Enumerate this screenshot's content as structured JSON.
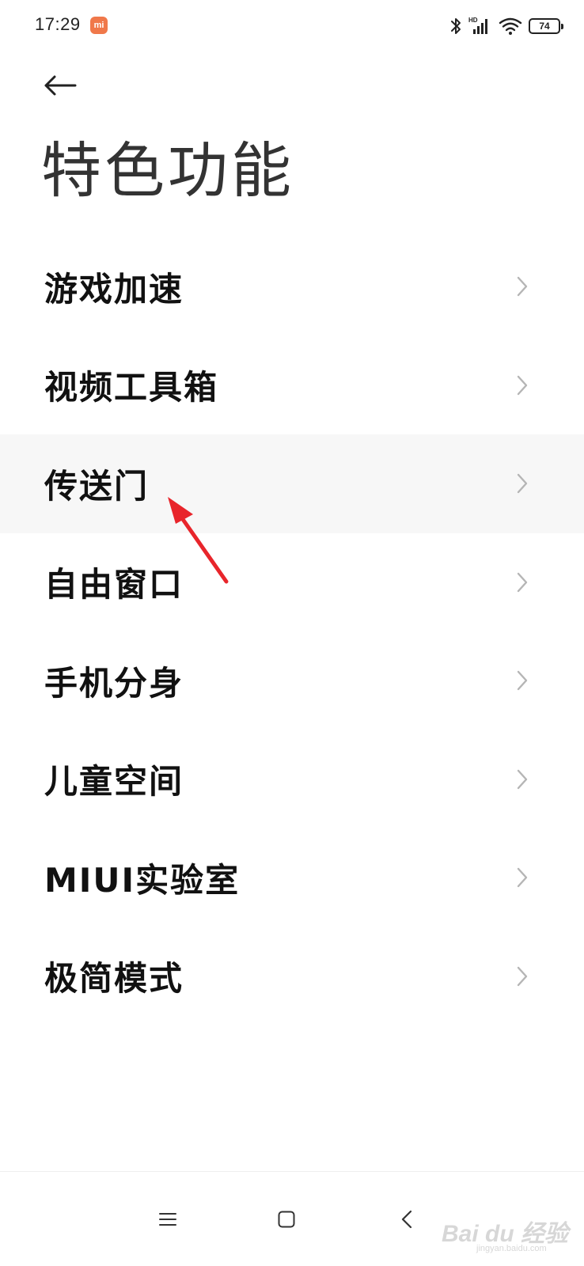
{
  "status_bar": {
    "time": "17:29",
    "badge": "mi",
    "battery_level": "74",
    "icons": [
      "bluetooth-icon",
      "hd-signal-icon",
      "wifi-icon",
      "battery-icon"
    ]
  },
  "header": {
    "back_icon": "arrow-left-icon",
    "title": "特色功能"
  },
  "menu": {
    "items": [
      {
        "label": "游戏加速"
      },
      {
        "label": "视频工具箱"
      },
      {
        "label": "传送门"
      },
      {
        "label": "自由窗口"
      },
      {
        "label": "手机分身"
      },
      {
        "label": "儿童空间"
      },
      {
        "label": "MIUI实验室"
      },
      {
        "label": "极简模式"
      }
    ],
    "highlighted_index": 2
  },
  "annotation": {
    "color": "#e8252b"
  },
  "nav_bar": {
    "icons": [
      "menu-icon",
      "home-icon",
      "back-icon"
    ]
  },
  "watermark": {
    "text": "Bai du 经验",
    "sub": "jingyan.baidu.com"
  }
}
